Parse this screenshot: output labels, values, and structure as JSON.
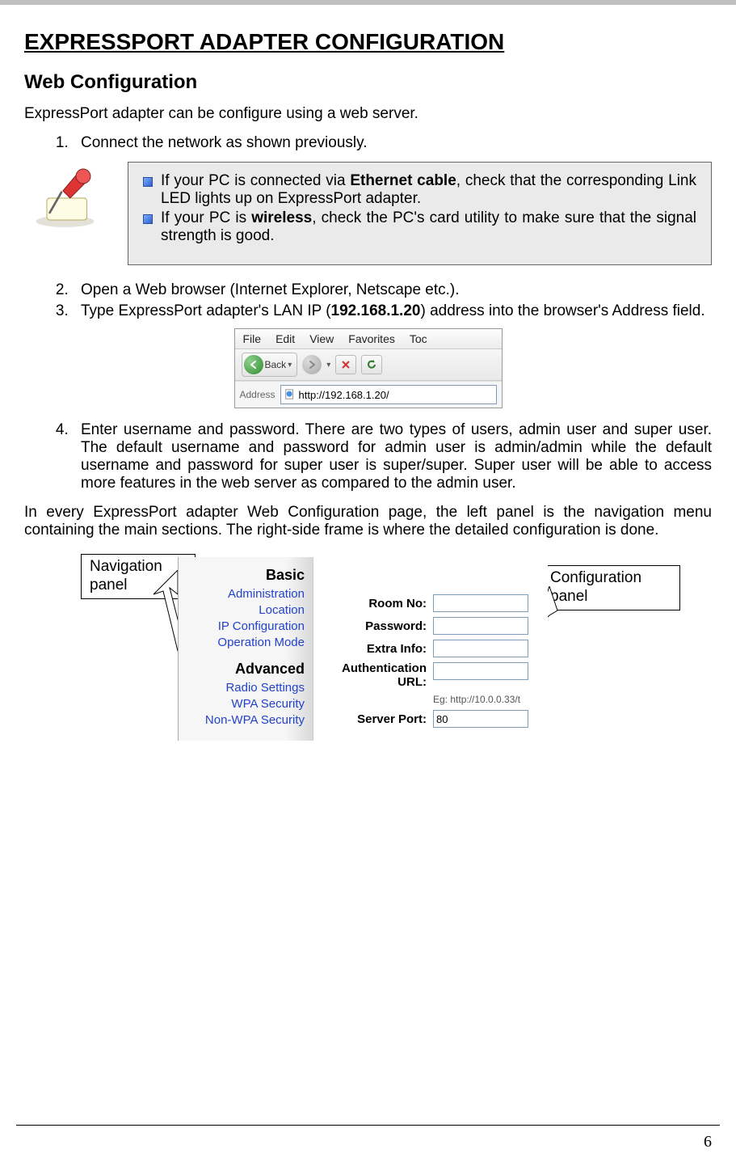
{
  "page_number": "6",
  "title": "EXPRESSPORT ADAPTER CONFIGURATION",
  "subtitle": "Web Configuration",
  "intro": "ExpressPort adapter can be configure using a web server.",
  "step1": "Connect the network as shown previously.",
  "note": {
    "line1_a": "If your PC is connected via ",
    "line1_b": "Ethernet cable",
    "line1_c": ", check that the corresponding Link LED lights up on ExpressPort adapter.",
    "line2_a": "If your PC is ",
    "line2_b": "wireless",
    "line2_c": ", check the PC's card utility to make sure that the signal strength is good."
  },
  "step2": "Open a Web browser (Internet Explorer, Netscape etc.).",
  "step3_a": "Type ExpressPort adapter's LAN IP (",
  "step3_b": "192.168.1.20",
  "step3_c": ") address into the browser's Address field.",
  "browser": {
    "menu": {
      "file": "File",
      "edit": "Edit",
      "view": "View",
      "favorites": "Favorites",
      "tools": "Toc"
    },
    "back_label": "Back",
    "address_label": "Address",
    "url": "http://192.168.1.20/"
  },
  "step4": "Enter username and password. There are two types of users, admin user and super user. The default username and password for admin user is admin/admin while the default username and password for super user is super/super. Super user will be able to access more features in the web server as compared to the admin user.",
  "para2": "In every ExpressPort adapter Web Configuration page, the left panel is the navigation menu containing the main sections. The right-side frame is where the detailed configuration is done.",
  "callouts": {
    "nav": "Navigation panel",
    "cfg": "Configuration panel"
  },
  "nav": {
    "basic": "Basic",
    "administration": "Administration",
    "location": "Location",
    "ipconfig": "IP Configuration",
    "opmode": "Operation Mode",
    "advanced": "Advanced",
    "radio": "Radio Settings",
    "wpa": "WPA Security",
    "nonwpa": "Non-WPA Security"
  },
  "form": {
    "room": "Room No:",
    "password": "Password:",
    "extra": "Extra Info:",
    "auth": "Authentication URL:",
    "auth_hint": "Eg: http://10.0.0.33/t",
    "port_label": "Server Port:",
    "port_value": "80"
  }
}
